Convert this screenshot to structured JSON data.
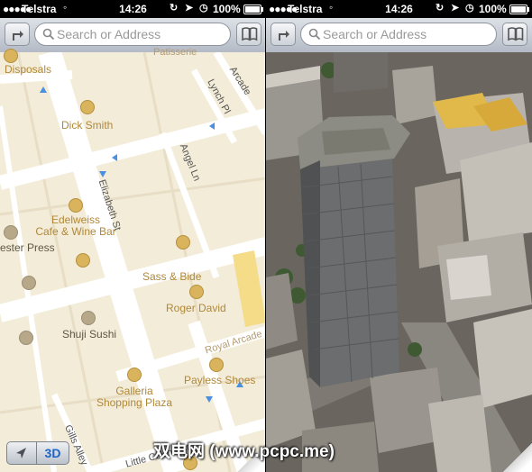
{
  "status_bar": {
    "carrier": "Telstra",
    "time": "14:26",
    "battery": "100%",
    "battery_level": 1.0
  },
  "toolbar": {
    "search_placeholder": "Search or Address",
    "directions_icon": "directions-arrow-icon",
    "bookmarks_icon": "book-icon",
    "search_icon": "magnifier-icon"
  },
  "map_2d": {
    "pois": [
      {
        "name": "Disposals"
      },
      {
        "name": "Dick Smith"
      },
      {
        "name": "Edelweiss\nCafe & Wine Bar"
      },
      {
        "name": "ester Press"
      },
      {
        "name": "Sass & Bide"
      },
      {
        "name": "Roger David"
      },
      {
        "name": "Shuji Sushi"
      },
      {
        "name": "Payless Shoes"
      },
      {
        "name": "Galleria\nShopping Plaza"
      }
    ],
    "streets": {
      "patisserie": "Patisserie",
      "arcade": "Arcade",
      "lynch": "Lynch Pl",
      "angel": "Angel Ln",
      "elizabeth": "Elizabeth St",
      "royal_arcade": "Royal Arcade",
      "gills": "Gills Alley",
      "little_collins": "Little Collins St"
    },
    "controls": {
      "locate_icon": "location-arrow-icon",
      "threed_label": "3D"
    }
  },
  "watermark": "双电网 (www.pcpc.me)",
  "colors": {
    "map_background": "#f3ecd8",
    "road": "#ffffff",
    "poi": "#d9b45c",
    "poi_label": "#b0883a",
    "threed_button": "#1d64c8",
    "toolbar": "#c8cdd4"
  }
}
